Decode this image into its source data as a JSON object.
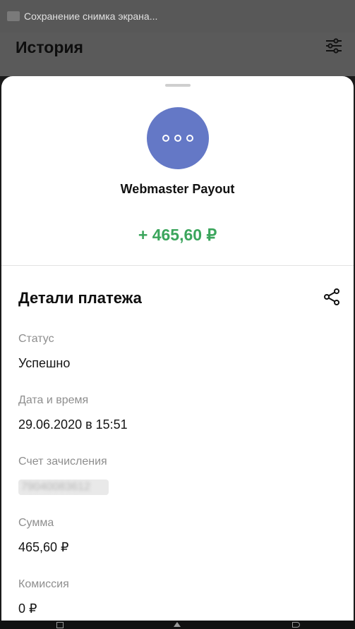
{
  "status_bar": {
    "notification_text": "Сохранение снимка экрана..."
  },
  "app_bar": {
    "title": "История",
    "filter_icon": "sliders-icon"
  },
  "transaction": {
    "merchant": "Webmaster Payout",
    "amount": "+ 465,60 ₽",
    "avatar_icon": "more-dots-icon"
  },
  "details": {
    "title": "Детали платежа",
    "share_icon": "share-icon",
    "fields": [
      {
        "label": "Статус",
        "value": "Успешно"
      },
      {
        "label": "Дата и время",
        "value": "29.06.2020 в 15:51"
      },
      {
        "label": "Счет зачисления",
        "value": "79040083612"
      },
      {
        "label": "Сумма",
        "value": "465,60 ₽"
      },
      {
        "label": "Комиссия",
        "value": "0 ₽"
      }
    ]
  },
  "nav_bar": {
    "icons": [
      "recent-apps-icon",
      "home-icon",
      "back-icon"
    ]
  },
  "colors": {
    "accent_green": "#3ba55c",
    "avatar_blue": "#6478c6"
  }
}
